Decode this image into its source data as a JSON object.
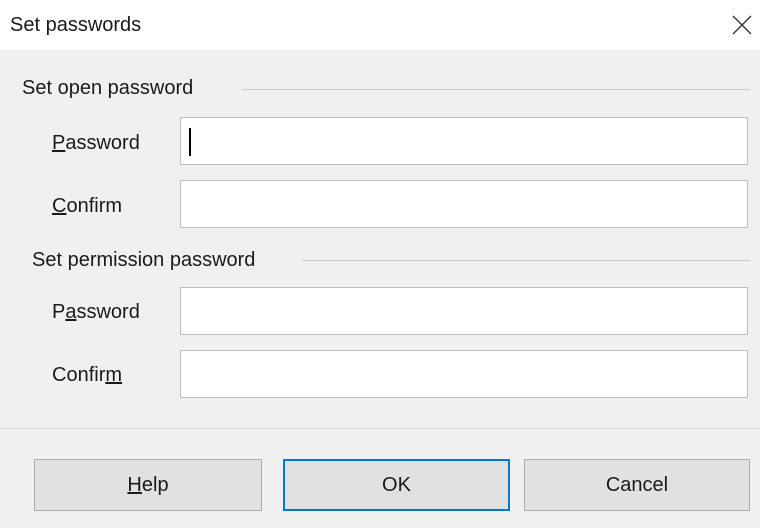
{
  "window": {
    "title": "Set passwords",
    "close_icon": "close-icon"
  },
  "open_section": {
    "heading": "Set open password",
    "password_label_ul": "P",
    "password_label_rest": "assword",
    "password_value": "",
    "confirm_label_ul": "C",
    "confirm_label_rest": "onfirm",
    "confirm_value": ""
  },
  "permission_section": {
    "heading": "Set permission password",
    "password_label_pre": "P",
    "password_label_ul": "a",
    "password_label_rest": "ssword",
    "password_value": "",
    "confirm_label_pre": "Confir",
    "confirm_label_ul": "m",
    "confirm_value": ""
  },
  "buttons": {
    "help_ul": "H",
    "help_rest": "elp",
    "ok": "OK",
    "cancel": "Cancel"
  },
  "colors": {
    "default_button_border": "#0078d7",
    "dialog_background": "#f0f0f0"
  }
}
